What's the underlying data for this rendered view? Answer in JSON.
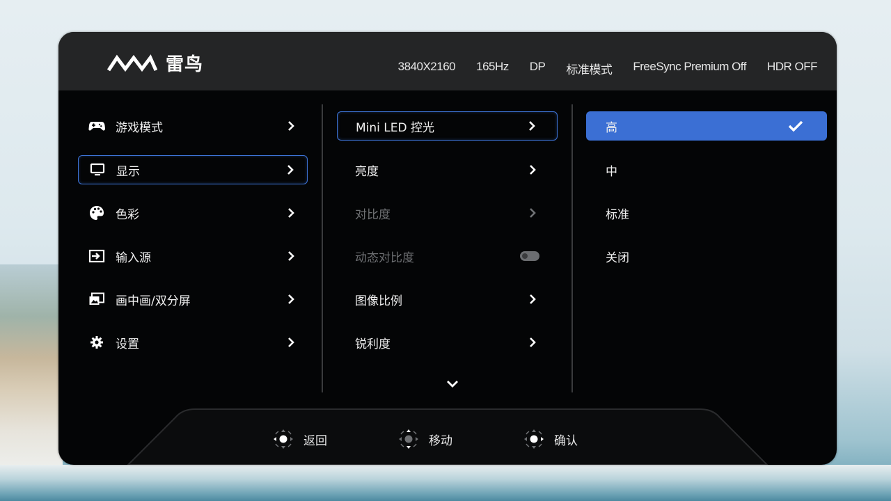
{
  "header": {
    "brand": "雷鸟",
    "status": [
      "3840X2160",
      "165Hz",
      "DP",
      "标准模式",
      "FreeSync Premium Off",
      "HDR OFF"
    ]
  },
  "menu": {
    "items": [
      {
        "label": "游戏模式",
        "icon": "gamepad-icon"
      },
      {
        "label": "显示",
        "icon": "monitor-icon",
        "selected": true
      },
      {
        "label": "色彩",
        "icon": "palette-icon"
      },
      {
        "label": "输入源",
        "icon": "input-source-icon"
      },
      {
        "label": "画中画/双分屏",
        "icon": "pip-icon"
      },
      {
        "label": "设置",
        "icon": "gear-icon"
      }
    ]
  },
  "submenu": {
    "items": [
      {
        "label": "Mini LED 控光",
        "selected": true,
        "enabled": true,
        "control": "chevron"
      },
      {
        "label": "亮度",
        "enabled": true,
        "control": "chevron"
      },
      {
        "label": "对比度",
        "enabled": false,
        "control": "chevron"
      },
      {
        "label": "动态对比度",
        "enabled": false,
        "control": "toggle",
        "toggle_on": false
      },
      {
        "label": "图像比例",
        "enabled": true,
        "control": "chevron"
      },
      {
        "label": "锐利度",
        "enabled": true,
        "control": "chevron"
      }
    ],
    "more_icon": "chevron-down-icon"
  },
  "options": {
    "items": [
      {
        "label": "高",
        "selected": true
      },
      {
        "label": "中"
      },
      {
        "label": "标准"
      },
      {
        "label": "关闭"
      }
    ]
  },
  "footer": {
    "back": "返回",
    "move": "移动",
    "confirm": "确认"
  },
  "colors": {
    "accent": "#3b6fd4",
    "panel": "#040506",
    "header": "#242526"
  }
}
